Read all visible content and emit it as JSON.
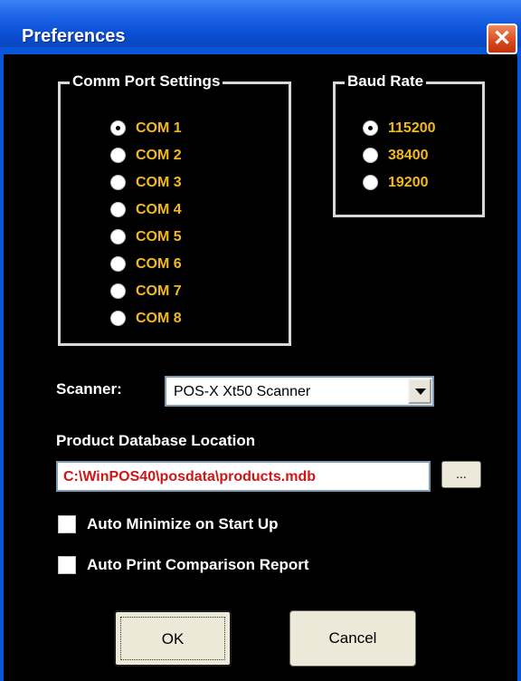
{
  "window": {
    "title": "Preferences"
  },
  "comm_port": {
    "title": "Comm Port Settings",
    "options": [
      "COM 1",
      "COM 2",
      "COM 3",
      "COM 4",
      "COM 5",
      "COM 6",
      "COM 7",
      "COM 8"
    ],
    "selected": "COM 1"
  },
  "baud_rate": {
    "title": "Baud Rate",
    "options": [
      "115200",
      "38400",
      "19200"
    ],
    "selected": "115200"
  },
  "scanner": {
    "label": "Scanner:",
    "value": "POS-X Xt50 Scanner"
  },
  "database": {
    "label": "Product Database Location",
    "path": "C:\\WinPOS40\\posdata\\products.mdb",
    "browse_label": "..."
  },
  "options": {
    "auto_minimize": {
      "label": "Auto Minimize on Start Up",
      "checked": false
    },
    "auto_print": {
      "label": "Auto Print Comparison Report",
      "checked": false
    }
  },
  "buttons": {
    "ok": "OK",
    "cancel": "Cancel"
  },
  "colors": {
    "option_text": "#f3b81c",
    "path_text": "#d21414",
    "title_bar": "#0a56d8",
    "client_bg": "#000000"
  }
}
